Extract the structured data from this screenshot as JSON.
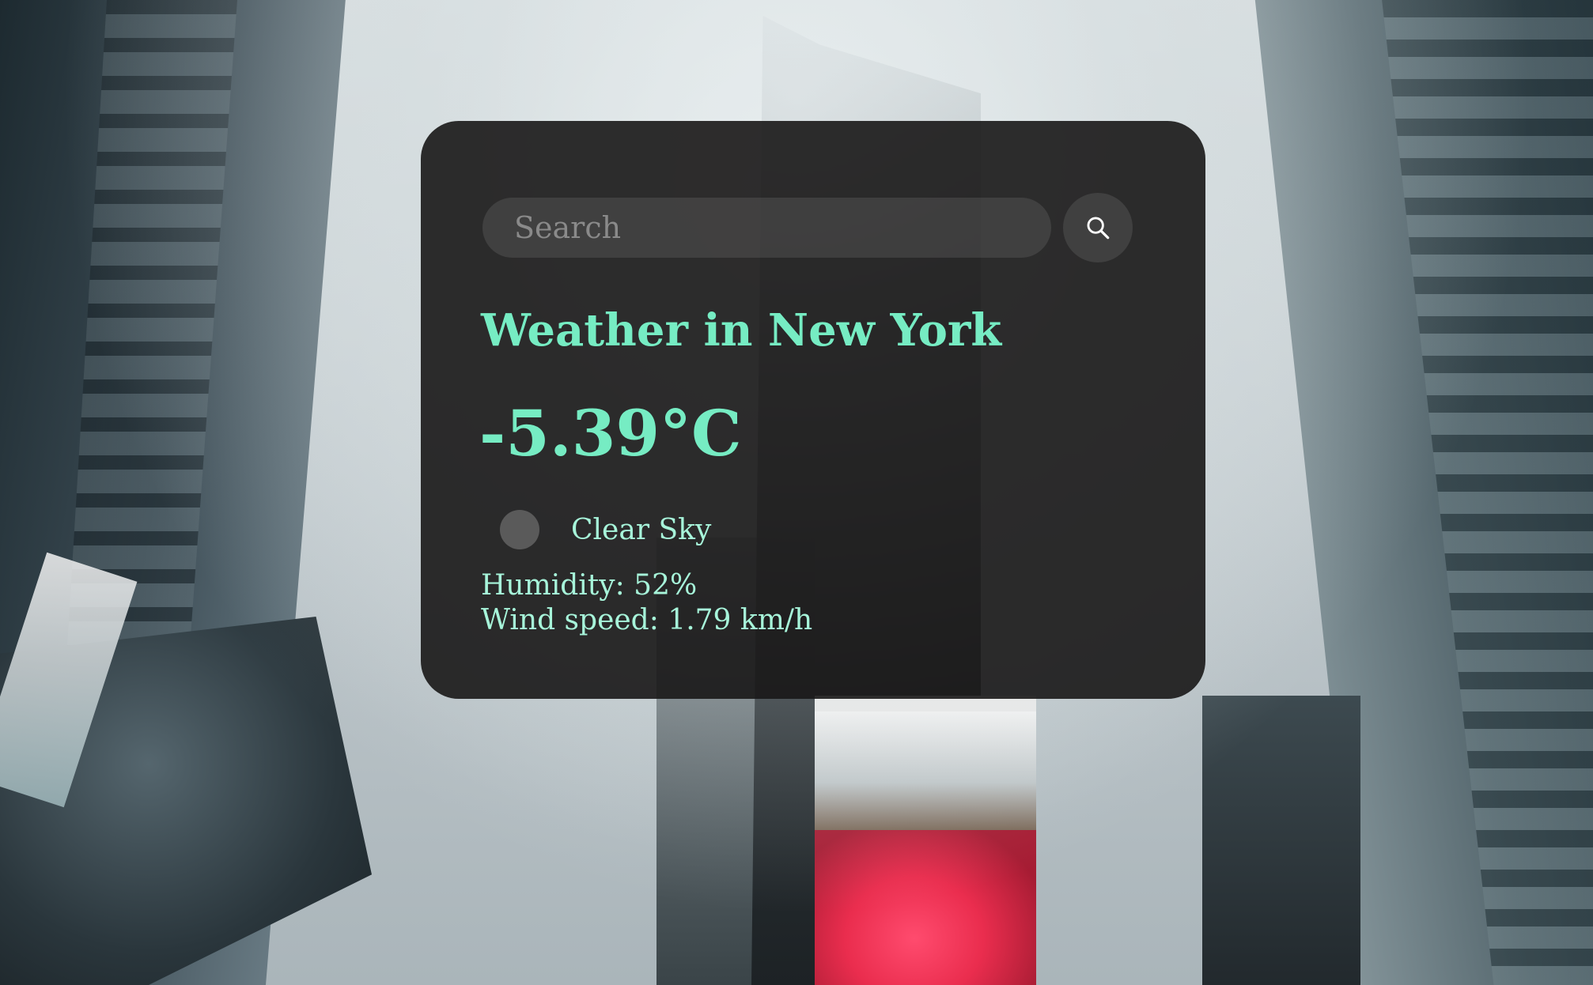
{
  "search": {
    "placeholder": "Search",
    "value": "",
    "button_icon": "search-icon"
  },
  "weather": {
    "title": "Weather in New York",
    "temperature": "-5.39°C",
    "description": "Clear Sky",
    "icon": "weather-condition-icon",
    "humidity": "Humidity: 52%",
    "wind_speed": "Wind speed: 1.79 km/h"
  },
  "colors": {
    "accent": "#76ecc3",
    "text_light": "#a7f5da",
    "card_bg": "#181717"
  }
}
